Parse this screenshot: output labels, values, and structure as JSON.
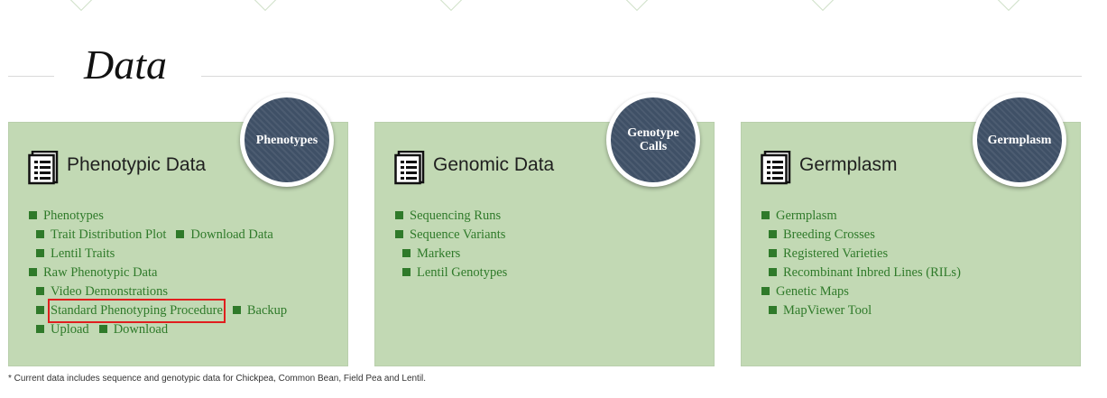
{
  "page": {
    "title": "Data",
    "footnote": "* Current data includes sequence and genotypic data for Chickpea, Common Bean, Field Pea and Lentil."
  },
  "colors": {
    "panel_bg": "#c2d9b4",
    "link": "#2f7a2a",
    "badge_bg": "#3f5066",
    "highlight": "#e01e1e"
  },
  "panels": [
    {
      "icon": "document-list-icon",
      "title": "Phenotypic Data",
      "badge": "Phenotypes",
      "rows": [
        [
          "Phenotypes"
        ],
        [
          "Trait Distribution Plot",
          "Download Data"
        ],
        [
          "Lentil Traits"
        ],
        [
          "Raw Phenotypic Data"
        ],
        [
          "Video Demonstrations"
        ],
        [
          "Standard Phenotyping Procedure",
          "Backup"
        ],
        [
          "Upload",
          "Download"
        ]
      ],
      "highlighted": "Standard Phenotyping Procedure"
    },
    {
      "icon": "document-list-icon",
      "title": "Genomic Data",
      "badge": "Genotype Calls",
      "rows": [
        [
          "Sequencing Runs"
        ],
        [
          "Sequence Variants"
        ],
        [
          "Markers"
        ],
        [
          "Lentil Genotypes"
        ]
      ]
    },
    {
      "icon": "document-list-icon",
      "title": "Germplasm",
      "badge": "Germplasm",
      "rows": [
        [
          "Germplasm"
        ],
        [
          "Breeding Crosses"
        ],
        [
          "Registered Varieties"
        ],
        [
          "Recombinant Inbred Lines (RILs)"
        ],
        [
          "Genetic Maps"
        ],
        [
          "MapViewer Tool"
        ]
      ]
    }
  ]
}
